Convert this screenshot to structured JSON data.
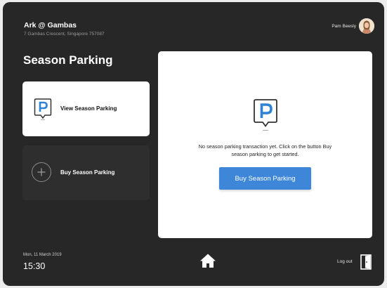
{
  "header": {
    "site_name": "Ark @ Gambas",
    "site_address": "7 Gambas Crescent, Singapore 757087",
    "user_name": "Pam Beesly",
    "avatar_icon": "user-avatar"
  },
  "page": {
    "title": "Season Parking"
  },
  "menu": {
    "view_label": "View Season Parking",
    "view_icon": "parking-sign-icon",
    "buy_label": "Buy Season Parking",
    "buy_icon": "plus-circle-icon"
  },
  "panel": {
    "icon": "parking-sign-icon",
    "message": "No season parking transaction yet. Click on the button Buy season parking to get started.",
    "button_label": "Buy Season Parking"
  },
  "footer": {
    "date": "Mon, 11 March 2019",
    "time": "15:30",
    "home_icon": "home-icon",
    "logout_label": "Log out",
    "logout_icon": "door-exit-icon"
  },
  "colors": {
    "background": "#272727",
    "card_active": "#ffffff",
    "card_inactive": "#2e2e2e",
    "accent": "#3d86d8",
    "parking_icon": "#2f82d6"
  }
}
